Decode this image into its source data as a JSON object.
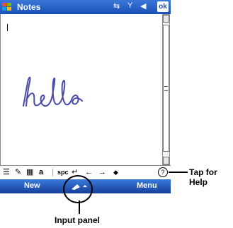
{
  "window": {
    "title": "Notes",
    "ok_label": "ok"
  },
  "notes": {
    "ink_text": "hello"
  },
  "input_bar": {
    "spc_label": "spc",
    "enter_glyph": "↵",
    "left_glyph": "←",
    "right_glyph": "→",
    "diamond_glyph": "◆",
    "help_glyph": "?"
  },
  "menu": {
    "left": "New",
    "right": "Menu"
  },
  "callouts": {
    "help": "Tap for Help",
    "input": "Input panel"
  }
}
